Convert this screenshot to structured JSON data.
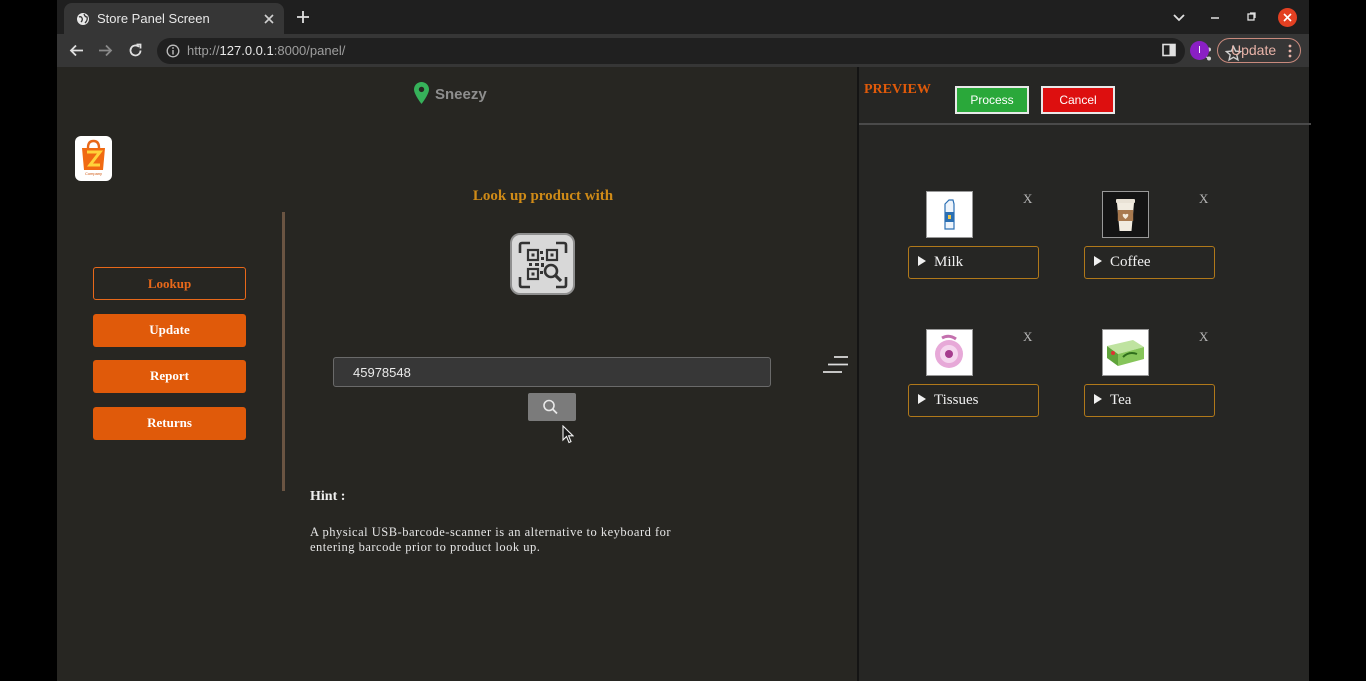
{
  "browser": {
    "tab_title": "Store Panel Screen",
    "url_prefix": "http://",
    "url_host": "127.0.0.1",
    "url_rest": ":8000/panel/",
    "profile_initial": "I",
    "update_label": "Update"
  },
  "page": {
    "location_name": "Sneezy",
    "logo_text": "Company",
    "nav": {
      "lookup": "Lookup",
      "update": "Update",
      "report": "Report",
      "returns": "Returns"
    },
    "lookup_title": "Look up product with",
    "barcode_value": "45978548",
    "hint_title": "Hint :",
    "hint_text": "A physical USB-barcode-scanner is an alternative to keyboard for entering barcode prior to product look up."
  },
  "preview": {
    "title": "PREVIEW",
    "process_label": "Process",
    "cancel_label": "Cancel",
    "remove_label": "X",
    "items": [
      {
        "name": "Milk",
        "icon": "milk-carton-icon"
      },
      {
        "name": "Coffee",
        "icon": "coffee-cup-icon"
      },
      {
        "name": "Tissues",
        "icon": "tissue-roll-icon"
      },
      {
        "name": "Tea",
        "icon": "tea-box-icon"
      }
    ]
  },
  "colors": {
    "accent_orange": "#e05a0a",
    "title_gold": "#d08b17",
    "process_green": "#2aa83a",
    "cancel_red": "#dd0f0f",
    "page_background": "#272622"
  }
}
